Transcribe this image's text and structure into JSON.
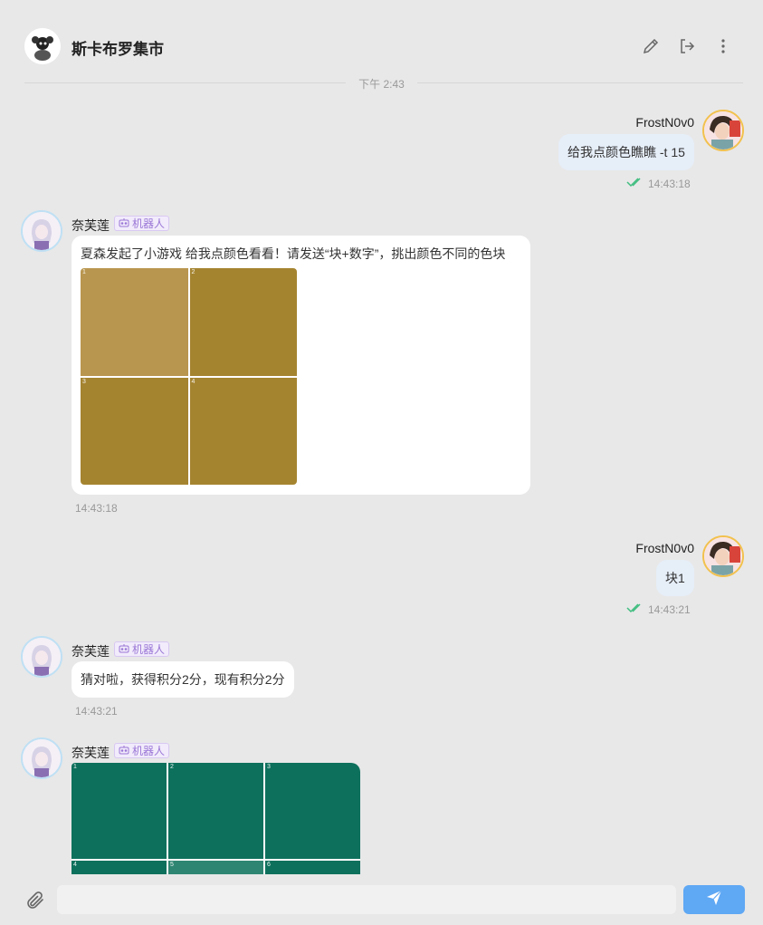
{
  "header": {
    "title": "斯卡布罗集市",
    "date_label": "下午 2:43"
  },
  "messages": [
    {
      "sender": "FrostN0v0",
      "text": "给我点颜色瞧瞧 -t 15",
      "time": "14:43:18"
    },
    {
      "sender": "奈芙莲",
      "badge": "机器人",
      "text": "夏森发起了小游戏 给我点颜色看看！请发送“块+数字”，挑出颜色不同的色块",
      "time": "14:43:18",
      "grid": {
        "cells": [
          "1",
          "2",
          "3",
          "4"
        ],
        "colors": [
          "#b9964f",
          "#a58430",
          "#a58430",
          "#a58430"
        ]
      }
    },
    {
      "sender": "FrostN0v0",
      "text": "块1",
      "time": "14:43:21"
    },
    {
      "sender": "奈芙莲",
      "badge": "机器人",
      "text": "猜对啦，获得积分2分，现有积分2分",
      "time": "14:43:21"
    },
    {
      "sender": "奈芙莲",
      "badge": "机器人",
      "grid": {
        "cells": [
          "1",
          "2",
          "3",
          "4",
          "5",
          "6"
        ],
        "colors": [
          "#0d705c",
          "#0d705c",
          "#0d705c",
          "#0d705c",
          "#2e8672",
          "#0d705c"
        ]
      }
    }
  ],
  "composer": {
    "placeholder": ""
  },
  "icons": {
    "edit": "pencil-icon",
    "exit": "exit-icon",
    "more": "more-vertical-icon",
    "attach": "paperclip-icon",
    "send": "send-icon",
    "robot": "robot-icon",
    "read": "double-check-icon"
  },
  "colors": {
    "background": "#e8e8e8",
    "bubble_self": "#e6eef8",
    "bubble_other": "#ffffff",
    "send_button": "#5fa8f4",
    "read_check": "#3fbd7f",
    "bot_badge": "#9a76d6"
  }
}
